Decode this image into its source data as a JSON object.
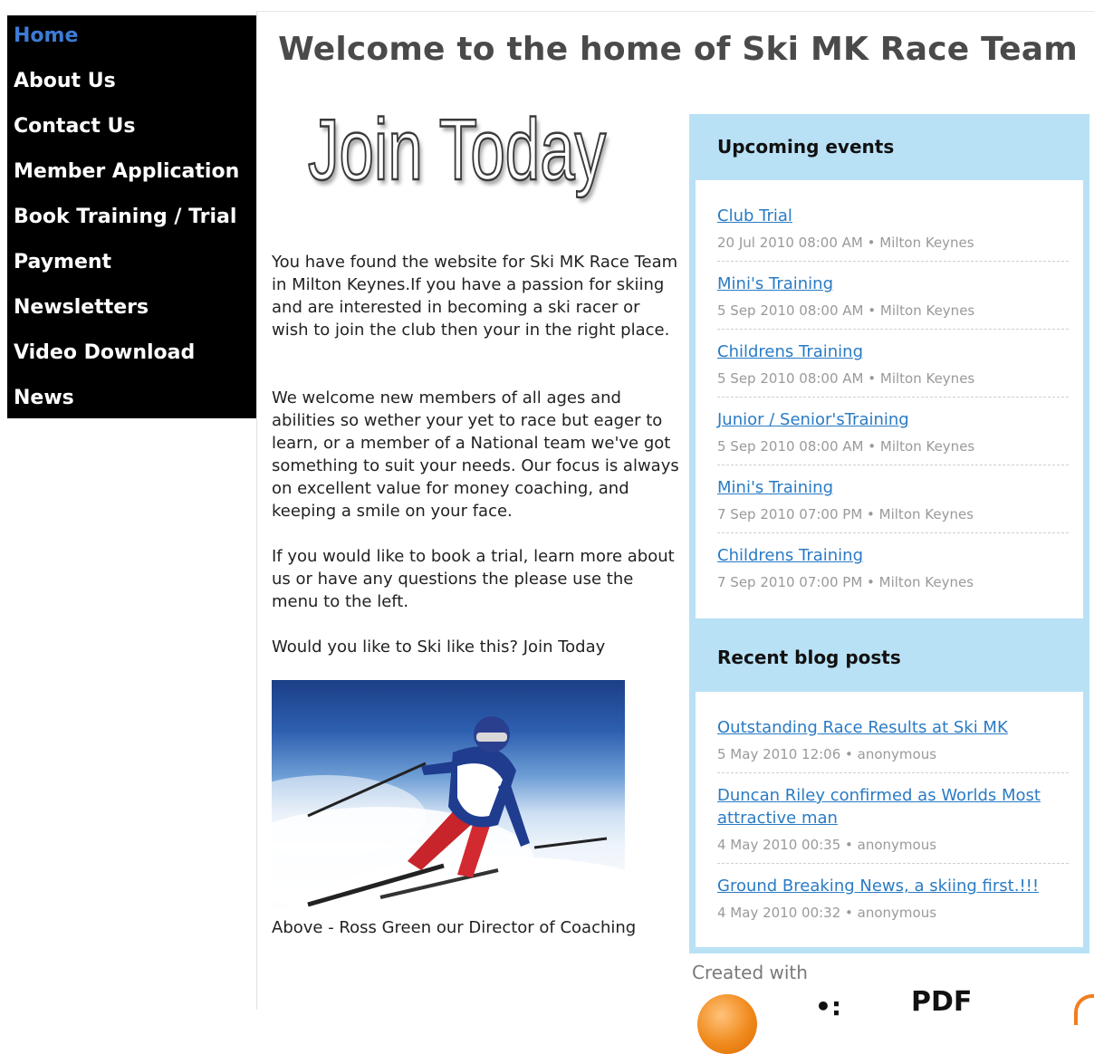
{
  "nav": {
    "items": [
      {
        "label": "Home",
        "active": true
      },
      {
        "label": "About Us"
      },
      {
        "label": "Contact Us"
      },
      {
        "label": "Member Application"
      },
      {
        "label": "Book Training / Trial"
      },
      {
        "label": "Payment"
      },
      {
        "label": "Newsletters"
      },
      {
        "label": "Video Download"
      },
      {
        "label": "News"
      }
    ]
  },
  "main": {
    "title": "Welcome to the home of Ski MK Race Team",
    "banner": "Join Today",
    "paragraphs": [
      "You have found the website for Ski MK Race Team in Milton Keynes.If you have a passion for skiing and are interested in becoming a ski racer or wish to join the club then your in the right place.",
      "We welcome  new members of all ages and abilities so wether your yet to race but eager to learn, or a member of a National team we've got something to suit your needs. Our focus is always on excellent value for money coaching, and keeping a smile on your face.",
      "If you would like to book a trial, learn more about us or have any questions the please use the menu to the left.",
      "Would you like to Ski like this? Join Today"
    ],
    "photo_caption": "Above - Ross Green our Director of Coaching"
  },
  "events": {
    "heading": "Upcoming events",
    "items": [
      {
        "title": "Club Trial",
        "meta": "20 Jul 2010 08:00 AM • Milton Keynes"
      },
      {
        "title": "Mini's Training",
        "meta": "5 Sep 2010 08:00 AM • Milton Keynes"
      },
      {
        "title": "Childrens Training",
        "meta": "5 Sep 2010 08:00 AM • Milton Keynes"
      },
      {
        "title": "Junior / Senior'sTraining",
        "meta": "5 Sep 2010 08:00 AM • Milton Keynes"
      },
      {
        "title": "Mini's Training",
        "meta": "7 Sep 2010 07:00 PM • Milton Keynes"
      },
      {
        "title": "Childrens Training",
        "meta": "7 Sep 2010 07:00 PM • Milton Keynes"
      }
    ]
  },
  "blog": {
    "heading": "Recent blog posts",
    "items": [
      {
        "title": "Outstanding Race Results at Ski MK",
        "meta": "5 May 2010 12:06 • anonymous"
      },
      {
        "title": "Duncan Riley confirmed as Worlds Most attractive man",
        "meta": "4 May 2010 00:35 • anonymous"
      },
      {
        "title": "Ground Breaking News, a skiing first.!!!",
        "meta": "4 May 2010 00:32 • anonymous"
      }
    ]
  },
  "footer": {
    "created_with": "Created with",
    "logo_text": "PDF"
  },
  "colors": {
    "nav_bg": "#000000",
    "nav_active": "#3d7bd6",
    "link": "#2a7bc4",
    "panel_bg": "#b9e1f6"
  }
}
